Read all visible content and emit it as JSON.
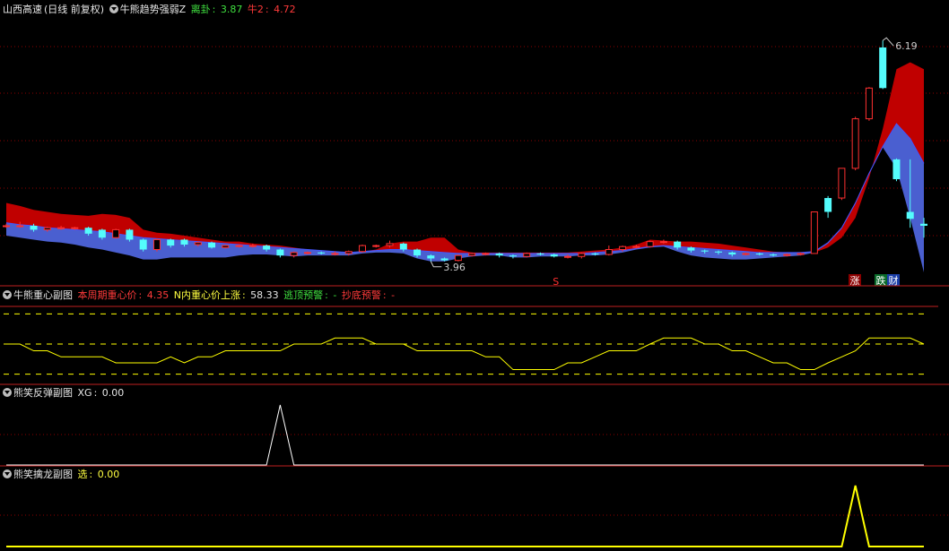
{
  "panel1": {
    "stock_name": "山西高速",
    "period": "(日线 前复权)",
    "indicator": "牛熊趋势强弱Z",
    "li_gua_label": "离卦",
    "li_gua_value": "3.87",
    "niu2_label": "牛2",
    "niu2_value": "4.72",
    "annotation_high": "6.19",
    "annotation_low": "3.96",
    "signal_s": "S",
    "signal_zhang": "涨",
    "signal_die": "跌",
    "signal_cai": "财"
  },
  "panel2": {
    "name": "牛熊重心副图",
    "label1": "本周期重心价",
    "value1": "4.35",
    "label2": "N内重心价上涨",
    "value2": "58.33",
    "label3": "逃顶预警",
    "value3": "-",
    "label4": "抄底预警",
    "value4": "-"
  },
  "panel3": {
    "name": "熊笑反弹副图",
    "label": "XG",
    "value": "0.00"
  },
  "panel4": {
    "name": "熊笑擒龙副图",
    "label": "选",
    "value": "0.00"
  },
  "colors": {
    "up": "#ff3030",
    "down": "#54fcfc",
    "bull_band": "#c00000",
    "bear_band": "#4a5fd0",
    "ma_line": "#4455ff",
    "line_yellow": "#ffff00",
    "grid_red": "#8b0000",
    "separator": "#c02020"
  },
  "chart_data": [
    {
      "type": "candlestick",
      "title": "山西高速 (日线 前复权)",
      "ylim": [
        3.75,
        6.4
      ],
      "x": [
        1,
        2,
        3,
        4,
        5,
        6,
        7,
        8,
        9,
        10,
        11,
        12,
        13,
        14,
        15,
        16,
        17,
        18,
        19,
        20,
        21,
        22,
        23,
        24,
        25,
        26,
        27,
        28,
        29,
        30,
        31,
        32,
        33,
        34,
        35,
        36,
        37,
        38,
        39,
        40,
        41,
        42,
        43,
        44,
        45,
        46,
        47,
        48,
        49,
        50,
        51,
        52,
        53,
        54,
        55,
        56,
        57,
        58,
        59,
        60,
        61,
        62,
        63,
        64,
        65,
        66,
        67,
        68
      ],
      "open": [
        4.32,
        4.32,
        4.32,
        4.28,
        4.3,
        4.3,
        4.3,
        4.28,
        4.2,
        4.28,
        4.18,
        4.08,
        4.18,
        4.18,
        4.13,
        4.15,
        4.1,
        4.12,
        4.12,
        4.12,
        4.08,
        4.02,
        4.05,
        4.05,
        4.04,
        4.04,
        4.06,
        4.12,
        4.12,
        4.14,
        4.08,
        4.02,
        3.99,
        3.97,
        4.02,
        4.04,
        4.04,
        4.02,
        4.01,
        4.04,
        4.03,
        4.01,
        4.01,
        4.04,
        4.03,
        4.08,
        4.11,
        4.11,
        4.16,
        4.16,
        4.1,
        4.07,
        4.06,
        4.05,
        4.03,
        4.04,
        4.03,
        4.02,
        4.03,
        4.04,
        4.6,
        4.6,
        4.9,
        5.4,
        6.12,
        4.99,
        4.46,
        4.34
      ],
      "close": [
        4.32,
        4.32,
        4.28,
        4.3,
        4.3,
        4.3,
        4.24,
        4.2,
        4.28,
        4.18,
        4.08,
        4.18,
        4.12,
        4.13,
        4.15,
        4.1,
        4.12,
        4.12,
        4.12,
        4.08,
        4.02,
        4.05,
        4.05,
        4.04,
        4.04,
        4.06,
        4.12,
        4.12,
        4.14,
        4.08,
        4.02,
        3.99,
        3.97,
        4.02,
        4.04,
        4.04,
        4.02,
        4.01,
        4.04,
        4.03,
        4.01,
        4.01,
        4.04,
        4.03,
        4.08,
        4.11,
        4.11,
        4.16,
        4.16,
        4.1,
        4.07,
        4.06,
        4.05,
        4.03,
        4.04,
        4.03,
        4.02,
        4.03,
        4.04,
        4.46,
        4.46,
        4.9,
        5.4,
        5.71,
        5.71,
        4.79,
        4.39,
        4.32
      ],
      "high": [
        4.34,
        4.36,
        4.34,
        4.31,
        4.32,
        4.31,
        4.31,
        4.29,
        4.29,
        4.29,
        4.19,
        4.19,
        4.19,
        4.19,
        4.16,
        4.16,
        4.13,
        4.13,
        4.14,
        4.13,
        4.09,
        4.06,
        4.06,
        4.06,
        4.06,
        4.07,
        4.13,
        4.13,
        4.17,
        4.15,
        4.09,
        4.03,
        4.0,
        4.03,
        4.05,
        4.05,
        4.05,
        4.03,
        4.05,
        4.05,
        4.04,
        4.03,
        4.05,
        4.05,
        4.12,
        4.12,
        4.13,
        4.17,
        4.18,
        4.17,
        4.11,
        4.08,
        4.07,
        4.06,
        4.05,
        4.05,
        4.04,
        4.04,
        4.05,
        4.46,
        4.62,
        4.9,
        5.42,
        5.72,
        6.19,
        5.0,
        4.99,
        4.4
      ],
      "low": [
        4.3,
        4.3,
        4.26,
        4.26,
        4.28,
        4.28,
        4.22,
        4.18,
        4.19,
        4.16,
        4.06,
        4.06,
        4.1,
        4.11,
        4.11,
        4.09,
        4.09,
        4.1,
        4.1,
        4.06,
        4.0,
        4.0,
        4.03,
        4.03,
        4.02,
        4.02,
        4.05,
        4.1,
        4.1,
        4.06,
        4.0,
        3.96,
        3.96,
        3.96,
        4.01,
        4.02,
        4.0,
        3.99,
        4.0,
        4.02,
        4.0,
        3.99,
        3.99,
        4.02,
        4.02,
        4.06,
        4.09,
        4.1,
        4.14,
        4.08,
        4.05,
        4.04,
        4.03,
        4.01,
        4.02,
        4.02,
        4.01,
        4.01,
        4.02,
        4.04,
        4.4,
        4.58,
        4.88,
        5.38,
        5.7,
        4.77,
        4.3,
        4.2
      ],
      "bull_top": [
        4.55,
        4.52,
        4.48,
        4.46,
        4.44,
        4.43,
        4.42,
        4.44,
        4.43,
        4.4,
        4.28,
        4.25,
        4.24,
        4.22,
        4.2,
        4.18,
        4.16,
        4.16,
        4.14,
        4.13,
        4.12,
        4.1,
        4.08,
        4.07,
        4.06,
        4.05,
        4.06,
        4.08,
        4.14,
        4.16,
        4.16,
        4.2,
        4.2,
        4.08,
        4.05,
        4.05,
        4.05,
        4.05,
        4.05,
        4.05,
        4.05,
        4.05,
        4.06,
        4.07,
        4.08,
        4.1,
        4.13,
        4.18,
        4.17,
        4.16,
        4.16,
        4.15,
        4.14,
        4.12,
        4.1,
        4.08,
        4.06,
        4.05,
        4.05,
        4.05,
        4.1,
        4.2,
        4.4,
        4.8,
        5.3,
        5.9,
        5.97,
        5.9
      ],
      "mid": [
        4.35,
        4.33,
        4.32,
        4.3,
        4.29,
        4.28,
        4.27,
        4.26,
        4.24,
        4.22,
        4.2,
        4.19,
        4.18,
        4.17,
        4.16,
        4.15,
        4.14,
        4.13,
        4.12,
        4.11,
        4.1,
        4.09,
        4.08,
        4.07,
        4.06,
        4.05,
        4.06,
        4.07,
        4.08,
        4.08,
        4.07,
        4.06,
        4.05,
        4.04,
        4.04,
        4.04,
        4.04,
        4.04,
        4.04,
        4.04,
        4.04,
        4.04,
        4.04,
        4.05,
        4.06,
        4.07,
        4.09,
        4.11,
        4.12,
        4.11,
        4.1,
        4.09,
        4.08,
        4.07,
        4.06,
        4.05,
        4.05,
        4.05,
        4.05,
        4.06,
        4.15,
        4.3,
        4.55,
        4.85,
        5.12,
        5.35,
        5.2,
        4.95
      ],
      "bear_bottom": [
        4.22,
        4.2,
        4.18,
        4.16,
        4.15,
        4.13,
        4.1,
        4.08,
        4.05,
        4.02,
        3.98,
        3.98,
        4.0,
        4.0,
        4.0,
        4.0,
        4.0,
        4.02,
        4.03,
        4.03,
        4.02,
        4.01,
        4.02,
        4.02,
        4.02,
        4.02,
        4.04,
        4.05,
        4.05,
        4.04,
        3.99,
        3.96,
        3.96,
        3.99,
        4.01,
        4.02,
        4.02,
        4.0,
        4.0,
        4.01,
        4.01,
        4.01,
        4.02,
        4.02,
        4.03,
        4.05,
        4.08,
        4.1,
        4.11,
        4.06,
        4.02,
        4.0,
        3.99,
        3.98,
        3.98,
        3.99,
        4.0,
        4.01,
        4.02,
        4.05,
        4.14,
        4.29,
        4.54,
        4.84,
        5.11,
        4.9,
        4.4,
        3.85
      ]
    },
    {
      "type": "line",
      "title": "牛熊重心副图",
      "ylim": [
        0,
        100
      ],
      "reference_lines": [
        10,
        50,
        90
      ],
      "x": [
        1,
        2,
        3,
        4,
        5,
        6,
        7,
        8,
        9,
        10,
        11,
        12,
        13,
        14,
        15,
        16,
        17,
        18,
        19,
        20,
        21,
        22,
        23,
        24,
        25,
        26,
        27,
        28,
        29,
        30,
        31,
        32,
        33,
        34,
        35,
        36,
        37,
        38,
        39,
        40,
        41,
        42,
        43,
        44,
        45,
        46,
        47,
        48,
        49,
        50,
        51,
        52,
        53,
        54,
        55,
        56,
        57,
        58,
        59,
        60,
        61,
        62,
        63,
        64,
        65,
        66,
        67,
        68
      ],
      "values": [
        50,
        50,
        41,
        41,
        33,
        33,
        33,
        33,
        25,
        25,
        25,
        25,
        33,
        25,
        33,
        33,
        41,
        41,
        41,
        41,
        41,
        50,
        50,
        50,
        58,
        58,
        58,
        50,
        50,
        50,
        41,
        41,
        41,
        41,
        41,
        33,
        33,
        16,
        16,
        16,
        16,
        25,
        25,
        33,
        41,
        41,
        41,
        50,
        58,
        58,
        58,
        50,
        50,
        41,
        41,
        33,
        25,
        25,
        16,
        16,
        25,
        33,
        41,
        58,
        58,
        58,
        58,
        50
      ]
    },
    {
      "type": "line",
      "title": "熊笑反弹副图",
      "ylim": [
        0,
        1
      ],
      "x": [
        1,
        2,
        3,
        4,
        5,
        6,
        7,
        8,
        9,
        10,
        11,
        12,
        13,
        14,
        15,
        16,
        17,
        18,
        19,
        20,
        21,
        22,
        23,
        24,
        25,
        26,
        27,
        28,
        29,
        30,
        31,
        32,
        33,
        34,
        35,
        36,
        37,
        38,
        39,
        40,
        41,
        42,
        43,
        44,
        45,
        46,
        47,
        48,
        49,
        50,
        51,
        52,
        53,
        54,
        55,
        56,
        57,
        58,
        59,
        60,
        61,
        62,
        63,
        64,
        65,
        66,
        67,
        68
      ],
      "values": [
        0,
        0,
        0,
        0,
        0,
        0,
        0,
        0,
        0,
        0,
        0,
        0,
        0,
        0,
        0,
        0,
        0,
        0,
        0,
        0,
        1,
        0,
        0,
        0,
        0,
        0,
        0,
        0,
        0,
        0,
        0,
        0,
        0,
        0,
        0,
        0,
        0,
        0,
        0,
        0,
        0,
        0,
        0,
        0,
        0,
        0,
        0,
        0,
        0,
        0,
        0,
        0,
        0,
        0,
        0,
        0,
        0,
        0,
        0,
        0,
        0,
        0,
        0,
        0,
        0,
        0,
        0,
        0
      ]
    },
    {
      "type": "line",
      "title": "熊笑擒龙副图",
      "ylim": [
        0,
        1
      ],
      "x": [
        1,
        2,
        3,
        4,
        5,
        6,
        7,
        8,
        9,
        10,
        11,
        12,
        13,
        14,
        15,
        16,
        17,
        18,
        19,
        20,
        21,
        22,
        23,
        24,
        25,
        26,
        27,
        28,
        29,
        30,
        31,
        32,
        33,
        34,
        35,
        36,
        37,
        38,
        39,
        40,
        41,
        42,
        43,
        44,
        45,
        46,
        47,
        48,
        49,
        50,
        51,
        52,
        53,
        54,
        55,
        56,
        57,
        58,
        59,
        60,
        61,
        62,
        63,
        64,
        65,
        66,
        67,
        68
      ],
      "values": [
        0,
        0,
        0,
        0,
        0,
        0,
        0,
        0,
        0,
        0,
        0,
        0,
        0,
        0,
        0,
        0,
        0,
        0,
        0,
        0,
        0,
        0,
        0,
        0,
        0,
        0,
        0,
        0,
        0,
        0,
        0,
        0,
        0,
        0,
        0,
        0,
        0,
        0,
        0,
        0,
        0,
        0,
        0,
        0,
        0,
        0,
        0,
        0,
        0,
        0,
        0,
        0,
        0,
        0,
        0,
        0,
        0,
        0,
        0,
        0,
        0,
        0,
        1,
        0,
        0,
        0,
        0,
        0
      ]
    }
  ]
}
